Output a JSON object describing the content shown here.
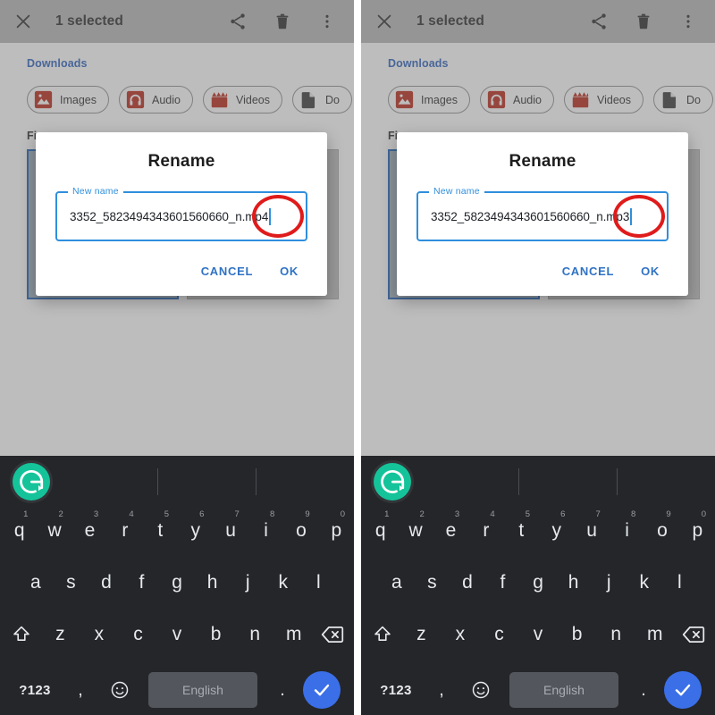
{
  "panels": [
    {
      "id": "left",
      "appbar": {
        "close_icon": "close-icon",
        "title": "1 selected",
        "share_icon": "share-icon",
        "delete_icon": "trash-icon",
        "overflow_icon": "more-vert-icon"
      },
      "breadcrumb": "Downloads",
      "chips": [
        {
          "label": "Images",
          "icon": "image-icon"
        },
        {
          "label": "Audio",
          "icon": "headphones-icon"
        },
        {
          "label": "Videos",
          "icon": "clapperboard-icon"
        },
        {
          "label": "Do",
          "icon": "document-icon"
        }
      ],
      "section_title": "Fi",
      "cards": [
        {
          "icon": "clapperboard-icon",
          "selected": true
        },
        {
          "icon": "document-icon",
          "selected": false
        }
      ],
      "dialog": {
        "title": "Rename",
        "field_label": "New name",
        "field_value": "3352_5823494343601560660_n.mp4",
        "cancel_label": "CANCEL",
        "ok_label": "OK",
        "annotation": "red-circle-highlight"
      },
      "keyboard": {
        "grammarly_icon": "grammarly-logo-icon",
        "row1": [
          {
            "key": "q",
            "num": "1"
          },
          {
            "key": "w",
            "num": "2"
          },
          {
            "key": "e",
            "num": "3"
          },
          {
            "key": "r",
            "num": "4"
          },
          {
            "key": "t",
            "num": "5"
          },
          {
            "key": "y",
            "num": "6"
          },
          {
            "key": "u",
            "num": "7"
          },
          {
            "key": "i",
            "num": "8"
          },
          {
            "key": "o",
            "num": "9"
          },
          {
            "key": "p",
            "num": "0"
          }
        ],
        "row2": [
          "a",
          "s",
          "d",
          "f",
          "g",
          "h",
          "j",
          "k",
          "l"
        ],
        "row3": [
          "z",
          "x",
          "c",
          "v",
          "b",
          "n",
          "m"
        ],
        "shift_icon": "shift-arrow-icon",
        "backspace_icon": "backspace-icon",
        "symbols_label": "?123",
        "comma_label": ",",
        "emoji_icon": "emoji-smiley-icon",
        "space_label": "English",
        "period_label": ".",
        "enter_icon": "checkmark-icon"
      }
    },
    {
      "id": "right",
      "appbar": {
        "close_icon": "close-icon",
        "title": "1 selected",
        "share_icon": "share-icon",
        "delete_icon": "trash-icon",
        "overflow_icon": "more-vert-icon"
      },
      "breadcrumb": "Downloads",
      "chips": [
        {
          "label": "Images",
          "icon": "image-icon"
        },
        {
          "label": "Audio",
          "icon": "headphones-icon"
        },
        {
          "label": "Videos",
          "icon": "clapperboard-icon"
        },
        {
          "label": "Do",
          "icon": "document-icon"
        }
      ],
      "section_title": "Fi",
      "cards": [
        {
          "icon": "clapperboard-icon",
          "selected": true
        },
        {
          "icon": "document-icon",
          "selected": false
        }
      ],
      "dialog": {
        "title": "Rename",
        "field_label": "New name",
        "field_value": "3352_5823494343601560660_n.mp3",
        "cancel_label": "CANCEL",
        "ok_label": "OK",
        "annotation": "red-circle-highlight"
      },
      "keyboard": {
        "grammarly_icon": "grammarly-logo-icon",
        "row1": [
          {
            "key": "q",
            "num": "1"
          },
          {
            "key": "w",
            "num": "2"
          },
          {
            "key": "e",
            "num": "3"
          },
          {
            "key": "r",
            "num": "4"
          },
          {
            "key": "t",
            "num": "5"
          },
          {
            "key": "y",
            "num": "6"
          },
          {
            "key": "u",
            "num": "7"
          },
          {
            "key": "i",
            "num": "8"
          },
          {
            "key": "o",
            "num": "9"
          },
          {
            "key": "p",
            "num": "0"
          }
        ],
        "row2": [
          "a",
          "s",
          "d",
          "f",
          "g",
          "h",
          "j",
          "k",
          "l"
        ],
        "row3": [
          "z",
          "x",
          "c",
          "v",
          "b",
          "n",
          "m"
        ],
        "shift_icon": "shift-arrow-icon",
        "backspace_icon": "backspace-icon",
        "symbols_label": "?123",
        "comma_label": ",",
        "emoji_icon": "emoji-smiley-icon",
        "space_label": "English",
        "period_label": ".",
        "enter_icon": "checkmark-icon"
      }
    }
  ],
  "colors": {
    "accent_blue": "#2f8fdc",
    "action_blue": "#2f72c4",
    "annotation_red": "#e01b1b",
    "media_red": "#c0392b",
    "grammarly_green": "#15c39a",
    "enter_blue": "#3b6fe8",
    "keyboard_bg": "#24262a",
    "scrim": "#b1b1b1"
  }
}
